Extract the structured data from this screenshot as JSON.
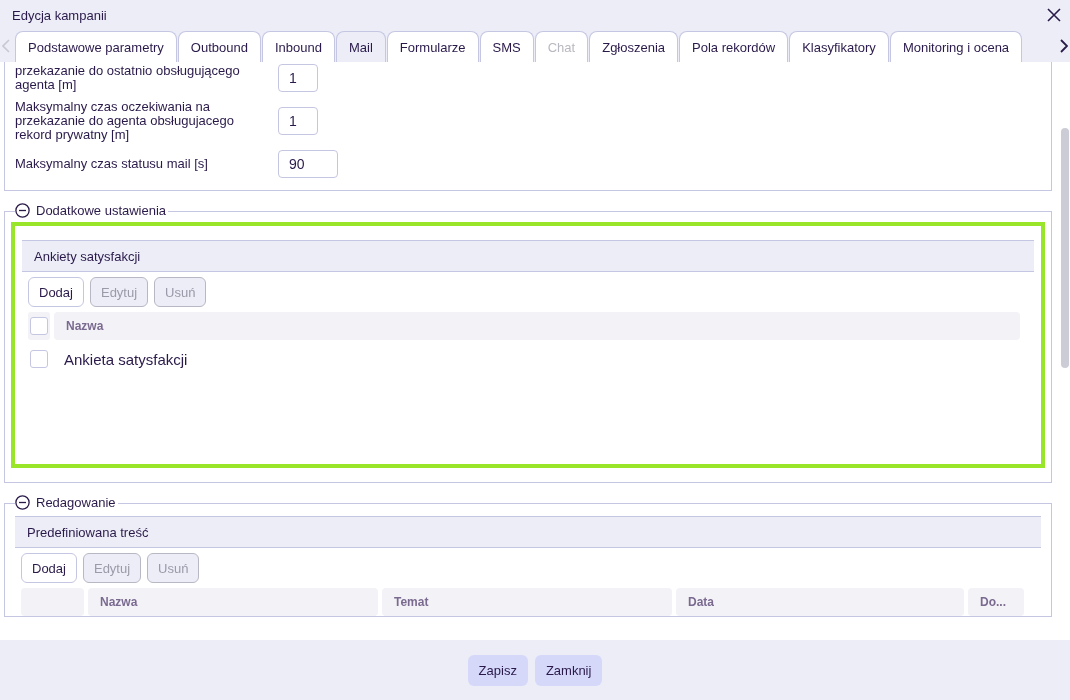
{
  "window": {
    "title": "Edycja kampanii"
  },
  "tabs": [
    {
      "label": "Podstawowe parametry",
      "selected": false,
      "disabled": false
    },
    {
      "label": "Outbound",
      "selected": false,
      "disabled": false
    },
    {
      "label": "Inbound",
      "selected": false,
      "disabled": false
    },
    {
      "label": "Mail",
      "selected": true,
      "disabled": false
    },
    {
      "label": "Formularze",
      "selected": false,
      "disabled": false
    },
    {
      "label": "SMS",
      "selected": false,
      "disabled": false
    },
    {
      "label": "Chat",
      "selected": false,
      "disabled": true
    },
    {
      "label": "Zgłoszenia",
      "selected": false,
      "disabled": false
    },
    {
      "label": "Pola rekordów",
      "selected": false,
      "disabled": false
    },
    {
      "label": "Klasyfikatory",
      "selected": false,
      "disabled": false
    },
    {
      "label": "Monitoring i ocena",
      "selected": false,
      "disabled": false
    }
  ],
  "settings": [
    {
      "label": "przekazanie do ostatnio obsługującego agenta [m]",
      "value": "1"
    },
    {
      "label": "Maksymalny czas oczekiwania na przekazanie do agenta obsługujacego rekord prywatny [m]",
      "value": "1"
    },
    {
      "label": "Maksymalny czas statusu mail [s]",
      "value": "90"
    }
  ],
  "additional_settings": {
    "title": "Dodatkowe ustawienia",
    "expanded": true,
    "highlighted": true,
    "panel": {
      "title": "Ankiety satysfakcji",
      "buttons": [
        {
          "label": "Dodaj",
          "disabled": false
        },
        {
          "label": "Edytuj",
          "disabled": true
        },
        {
          "label": "Usuń",
          "disabled": true
        }
      ],
      "header_checked": false,
      "column": "Nazwa",
      "rows": [
        {
          "name": "Ankieta satysfakcji",
          "checked": false
        }
      ]
    }
  },
  "editing": {
    "title": "Redagowanie",
    "expanded": true,
    "panel": {
      "title": "Predefiniowana treść",
      "buttons": [
        {
          "label": "Dodaj",
          "disabled": false
        },
        {
          "label": "Edytuj",
          "disabled": true
        },
        {
          "label": "Usuń",
          "disabled": true
        }
      ],
      "columns": [
        "Nazwa",
        "Temat",
        "Data",
        "Do..."
      ]
    }
  },
  "footer_buttons": [
    "Zapisz",
    "Zamknij"
  ]
}
